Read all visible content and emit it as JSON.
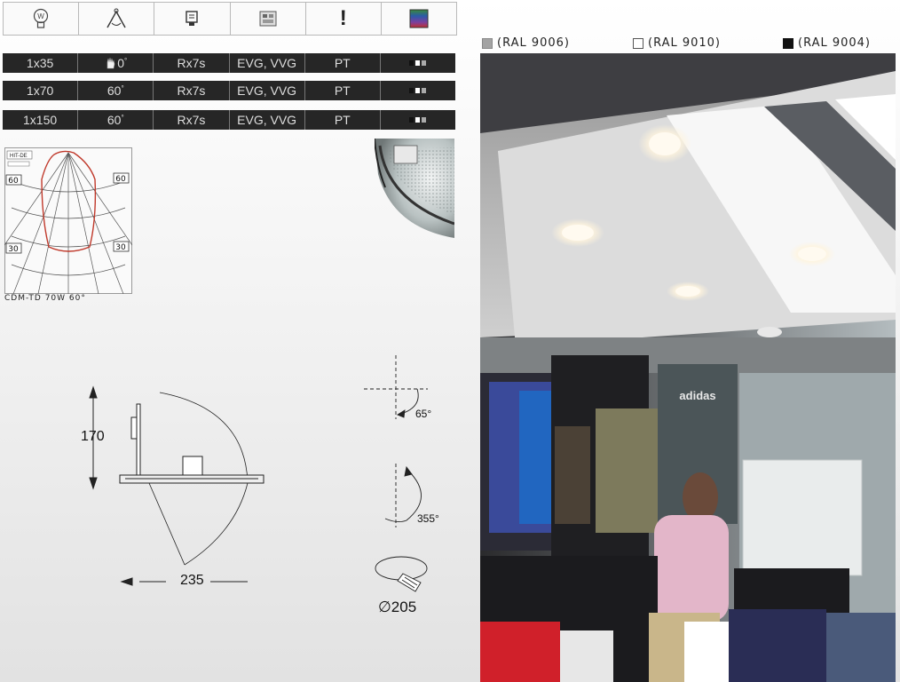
{
  "header_icons": [
    {
      "name": "lamp-wattage-icon"
    },
    {
      "name": "beam-angle-icon"
    },
    {
      "name": "lamp-socket-icon"
    },
    {
      "name": "control-gear-icon"
    },
    {
      "name": "warning-icon",
      "text": "!"
    },
    {
      "name": "color-options-icon"
    }
  ],
  "ral_colors": [
    {
      "label": "(RAL 9006)",
      "color": "#a3a3a3"
    },
    {
      "label": "(RAL 9010)",
      "color": "#ffffff"
    },
    {
      "label": "(RAL 9004)",
      "color": "#111111"
    }
  ],
  "spec_rows": [
    {
      "power": "1x35",
      "angle": "0",
      "angle_unit": "°",
      "socket": "Rx7s",
      "gear": "EVG, VVG",
      "lamp": "PT"
    },
    {
      "power": "1x70",
      "angle": "60",
      "angle_unit": "°",
      "socket": "Rx7s",
      "gear": "EVG, VVG",
      "lamp": "PT"
    },
    {
      "power": "1x150",
      "angle": "60",
      "angle_unit": "°",
      "socket": "Rx7s",
      "gear": "EVG, VVG",
      "lamp": "PT"
    }
  ],
  "polar": {
    "lamp_label": "HIT-DE",
    "angle_top_left": "60",
    "angle_top_right": "60",
    "angle_bottom_left": "30",
    "angle_bottom_right": "30",
    "caption": "CDM-TD 70W 60°"
  },
  "dimensions": {
    "height": "170",
    "width": "235",
    "tilt": "65°",
    "rotation": "355°",
    "cutout": "∅205"
  },
  "photo": {
    "brand": "adidas"
  }
}
